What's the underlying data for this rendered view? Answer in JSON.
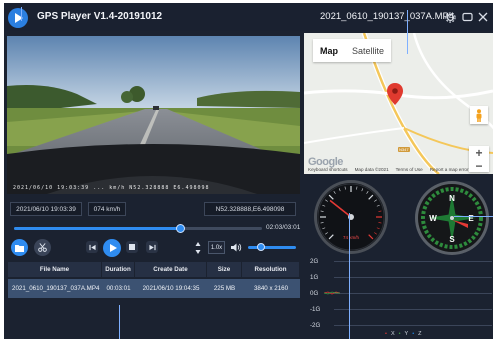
{
  "app": {
    "title": "GPS Player V1.4-20191012",
    "file_title": "2021_0610_190137_037A.MP4"
  },
  "window_controls": {
    "settings_icon": "gear-icon",
    "restore_icon": "window-restore-icon",
    "close_icon": "close-icon"
  },
  "video": {
    "osd_text": "2021/06/10 19:03:39  ... km/h   N52.328888 E6.498098"
  },
  "info": {
    "date_time": "2021/06/10    19:03:39",
    "speed": "074 km/h",
    "coordinates": "N52.328888,E6.498098"
  },
  "playback": {
    "progress": 0.67,
    "time": "02:03/03:01",
    "speed_label": "1.0x",
    "volume": 0.27
  },
  "table": {
    "headers": [
      "File Name",
      "Duration",
      "Create Date",
      "Size",
      "Resolution"
    ],
    "rows": [
      [
        "2021_0610_190137_037A.MP4",
        "00:03:01",
        "2021/06/10   19:04:35",
        "225 MB",
        "3840 x 2160"
      ]
    ]
  },
  "map": {
    "tabs": [
      "Map",
      "Satellite"
    ],
    "active_tab": "Map",
    "road_label": "N347",
    "logo": "Google",
    "footer": [
      "Keyboard shortcuts",
      "Map data ©2021",
      "Terms of Use",
      "Report a map error"
    ],
    "zoom_in": "+",
    "zoom_out": "−"
  },
  "speedometer": {
    "readout": "74 km/h",
    "value": 74
  },
  "compass": {
    "labels": [
      "N",
      "E",
      "S",
      "W"
    ]
  },
  "gsensor": {
    "axis_labels": [
      "2G",
      "1G",
      "0G",
      "-1G",
      "-2G"
    ],
    "legend": [
      "X",
      "Y",
      "Z"
    ],
    "colors": {
      "x": "#e53935",
      "y": "#43a047",
      "z": "#1e88e5"
    }
  },
  "colors": {
    "accent": "#2f8cf0",
    "background": "#1b2230",
    "selected_row": "#3c5272"
  }
}
